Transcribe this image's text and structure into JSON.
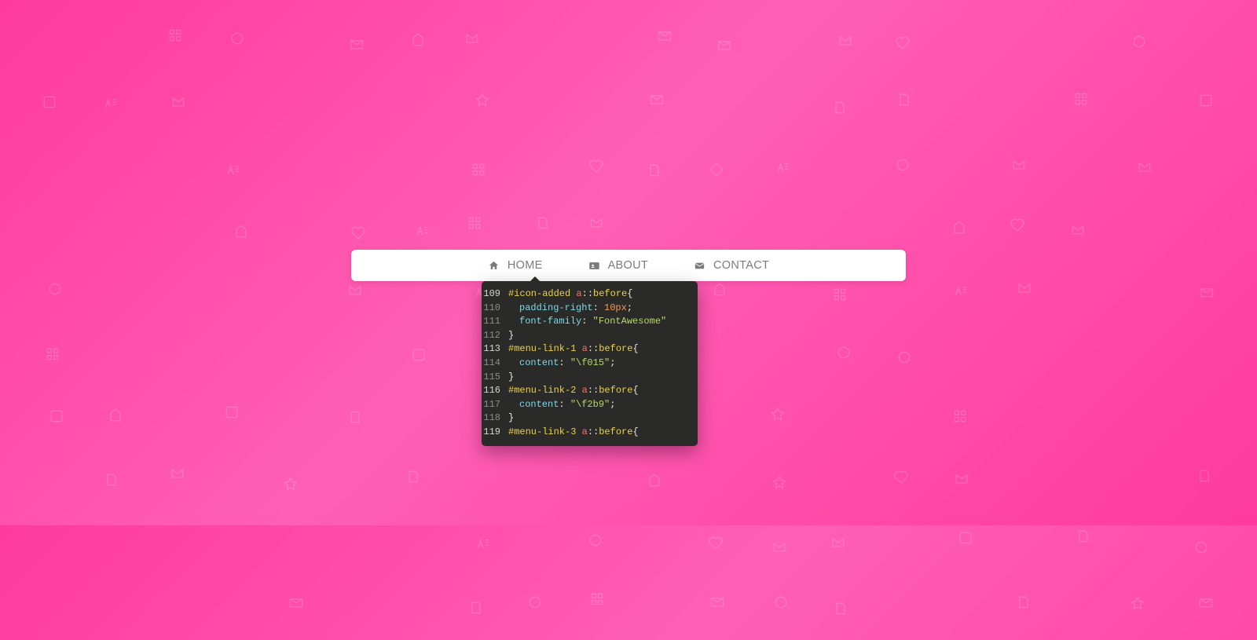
{
  "nav": {
    "items": [
      {
        "label": "HOME",
        "icon": "home-icon"
      },
      {
        "label": "ABOUT",
        "icon": "address-card-icon"
      },
      {
        "label": "CONTACT",
        "icon": "envelope-icon"
      }
    ]
  },
  "code": {
    "lines": [
      {
        "n": "109",
        "hl": true,
        "tokens": [
          {
            "c": "sel",
            "t": "#icon-added "
          },
          {
            "c": "tag",
            "t": "a"
          },
          {
            "c": "pun",
            "t": "::"
          },
          {
            "c": "ps",
            "t": "before"
          },
          {
            "c": "brace",
            "t": "{"
          }
        ]
      },
      {
        "n": "110",
        "hl": false,
        "tokens": [
          {
            "c": "indent",
            "t": ""
          },
          {
            "c": "prop",
            "t": "padding-right"
          },
          {
            "c": "pun",
            "t": ": "
          },
          {
            "c": "num",
            "t": "10px"
          },
          {
            "c": "pun",
            "t": ";"
          }
        ]
      },
      {
        "n": "111",
        "hl": false,
        "tokens": [
          {
            "c": "indent",
            "t": ""
          },
          {
            "c": "prop",
            "t": "font-family"
          },
          {
            "c": "pun",
            "t": ": "
          },
          {
            "c": "str",
            "t": "\"FontAwesome\""
          }
        ]
      },
      {
        "n": "112",
        "hl": false,
        "tokens": [
          {
            "c": "brace",
            "t": "}"
          }
        ]
      },
      {
        "n": "113",
        "hl": true,
        "tokens": [
          {
            "c": "sel",
            "t": "#menu-link-1 "
          },
          {
            "c": "tag",
            "t": "a"
          },
          {
            "c": "pun",
            "t": "::"
          },
          {
            "c": "ps",
            "t": "before"
          },
          {
            "c": "brace",
            "t": "{"
          }
        ]
      },
      {
        "n": "114",
        "hl": false,
        "tokens": [
          {
            "c": "indent",
            "t": ""
          },
          {
            "c": "prop",
            "t": "content"
          },
          {
            "c": "pun",
            "t": ": "
          },
          {
            "c": "str",
            "t": "\"\\f015\""
          },
          {
            "c": "pun",
            "t": ";"
          }
        ]
      },
      {
        "n": "115",
        "hl": false,
        "tokens": [
          {
            "c": "brace",
            "t": "}"
          }
        ]
      },
      {
        "n": "116",
        "hl": true,
        "tokens": [
          {
            "c": "sel",
            "t": "#menu-link-2 "
          },
          {
            "c": "tag",
            "t": "a"
          },
          {
            "c": "pun",
            "t": "::"
          },
          {
            "c": "ps",
            "t": "before"
          },
          {
            "c": "brace",
            "t": "{"
          }
        ]
      },
      {
        "n": "117",
        "hl": false,
        "tokens": [
          {
            "c": "indent",
            "t": ""
          },
          {
            "c": "prop",
            "t": "content"
          },
          {
            "c": "pun",
            "t": ": "
          },
          {
            "c": "str",
            "t": "\"\\f2b9\""
          },
          {
            "c": "pun",
            "t": ";"
          }
        ]
      },
      {
        "n": "118",
        "hl": false,
        "tokens": [
          {
            "c": "brace",
            "t": "}"
          }
        ]
      },
      {
        "n": "119",
        "hl": true,
        "tokens": [
          {
            "c": "sel",
            "t": "#menu-link-3 "
          },
          {
            "c": "tag",
            "t": "a"
          },
          {
            "c": "pun",
            "t": "::"
          },
          {
            "c": "ps",
            "t": "before"
          },
          {
            "c": "brace",
            "t": "{"
          }
        ]
      }
    ]
  }
}
